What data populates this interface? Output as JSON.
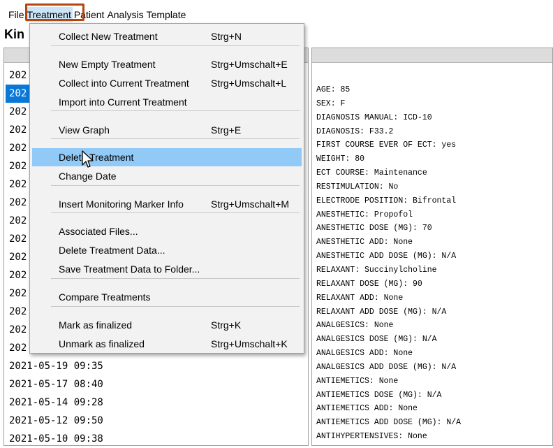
{
  "menubar": {
    "items": [
      "File",
      "Treatment",
      "Patient",
      "Analysis",
      "Template"
    ]
  },
  "app_title": "Kin",
  "list": {
    "rows": [
      "202",
      "202",
      "202",
      "202",
      "202",
      "202",
      "202",
      "202",
      "202",
      "202",
      "202",
      "202",
      "202",
      "202",
      "202",
      "202",
      "2021-05-19 09:35",
      "2021-05-17 08:40",
      "2021-05-14 09:28",
      "2021-05-12 09:50",
      "2021-05-10 09:38"
    ],
    "selected_index": 1
  },
  "dropdown": {
    "items": [
      {
        "label": "Collect New Treatment",
        "shortcut": "Strg+N"
      },
      {
        "label": "New Empty Treatment",
        "shortcut": "Strg+Umschalt+E"
      },
      {
        "label": "Collect into Current Treatment",
        "shortcut": "Strg+Umschalt+L"
      },
      {
        "label": "Import into Current Treatment",
        "shortcut": ""
      },
      {
        "label": "View Graph",
        "shortcut": "Strg+E"
      },
      {
        "label": "Delete Treatment",
        "shortcut": ""
      },
      {
        "label": "Change Date",
        "shortcut": ""
      },
      {
        "label": "Insert Monitoring Marker Info",
        "shortcut": "Strg+Umschalt+M"
      },
      {
        "label": "Associated Files...",
        "shortcut": ""
      },
      {
        "label": "Delete Treatment Data...",
        "shortcut": ""
      },
      {
        "label": "Save Treatment Data to Folder...",
        "shortcut": ""
      },
      {
        "label": "Compare Treatments",
        "shortcut": ""
      },
      {
        "label": "Mark as finalized",
        "shortcut": "Strg+K"
      },
      {
        "label": "Unmark as finalized",
        "shortcut": "Strg+Umschalt+K"
      }
    ],
    "highlighted_index": 5
  },
  "details": {
    "lines": [
      "AGE: 85",
      "SEX: F",
      "DIAGNOSIS MANUAL: ICD-10",
      "DIAGNOSIS: F33.2",
      "FIRST COURSE EVER OF ECT: yes",
      "WEIGHT: 80",
      "ECT COURSE: Maintenance",
      "RESTIMULATION: No",
      "ELECTRODE POSITION: Bifrontal",
      "ANESTHETIC: Propofol",
      "ANESTHETIC DOSE (MG): 70",
      "ANESTHETIC ADD: None",
      "ANESTHETIC ADD DOSE (MG): N/A",
      "RELAXANT: Succinylcholine",
      "RELAXANT DOSE (MG): 90",
      "RELAXANT ADD: None",
      "RELAXANT ADD DOSE (MG): N/A",
      "ANALGESICS: None",
      "ANALGESICS DOSE (MG): N/A",
      "ANALGESICS ADD: None",
      "ANALGESICS ADD DOSE (MG): N/A",
      "ANTIEMETICS: None",
      "ANTIEMETICS DOSE (MG): N/A",
      "ANTIEMETICS ADD: None",
      "ANTIEMETICS ADD DOSE (MG): N/A",
      "ANTIHYPERTENSIVES: None"
    ]
  },
  "colors": {
    "highlight_box": "#b4470d",
    "selection": "#0a78d7",
    "menu_hover": "#91c9f7"
  },
  "icons": {
    "cursor": "mouse-pointer-icon"
  }
}
